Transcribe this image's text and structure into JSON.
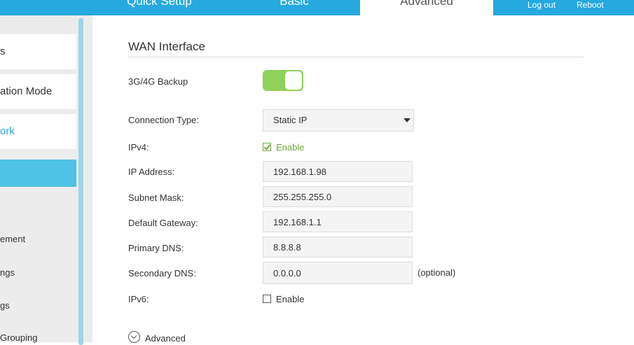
{
  "nav": {
    "tabs": [
      "Quick Setup",
      "Basic",
      "Advanced"
    ],
    "active_tab": "Advanced",
    "log_out": "Log out",
    "reboot": "Reboot"
  },
  "sidebar": {
    "items": [
      "s",
      "ation Mode",
      "ork",
      ""
    ],
    "subitems": [
      "ement",
      "ngs",
      "gs",
      "Grouping"
    ]
  },
  "main": {
    "title": "WAN Interface",
    "backup_label": "3G/4G Backup",
    "backup_on": true,
    "connection_type_label": "Connection Type:",
    "connection_type_value": "Static IP",
    "ipv4_label": "IPv4:",
    "ipv4_enable": "Enable",
    "ip_address_label": "IP Address:",
    "ip_address_value": "192.168.1.98",
    "subnet_label": "Subnet Mask:",
    "subnet_value": "255.255.255.0",
    "gateway_label": "Default Gateway:",
    "gateway_value": "192.168.1.1",
    "primary_dns_label": "Primary DNS:",
    "primary_dns_value": "8.8.8.8",
    "secondary_dns_label": "Secondary DNS:",
    "secondary_dns_value": "0.0.0.0",
    "optional": "(optional)",
    "ipv6_label": "IPv6:",
    "ipv6_enable": "Enable",
    "advanced_label": "Advanced"
  },
  "colors": {
    "accent": "#26a9df",
    "toggle_on": "#8fd15a",
    "check_green": "#6aa83c"
  }
}
